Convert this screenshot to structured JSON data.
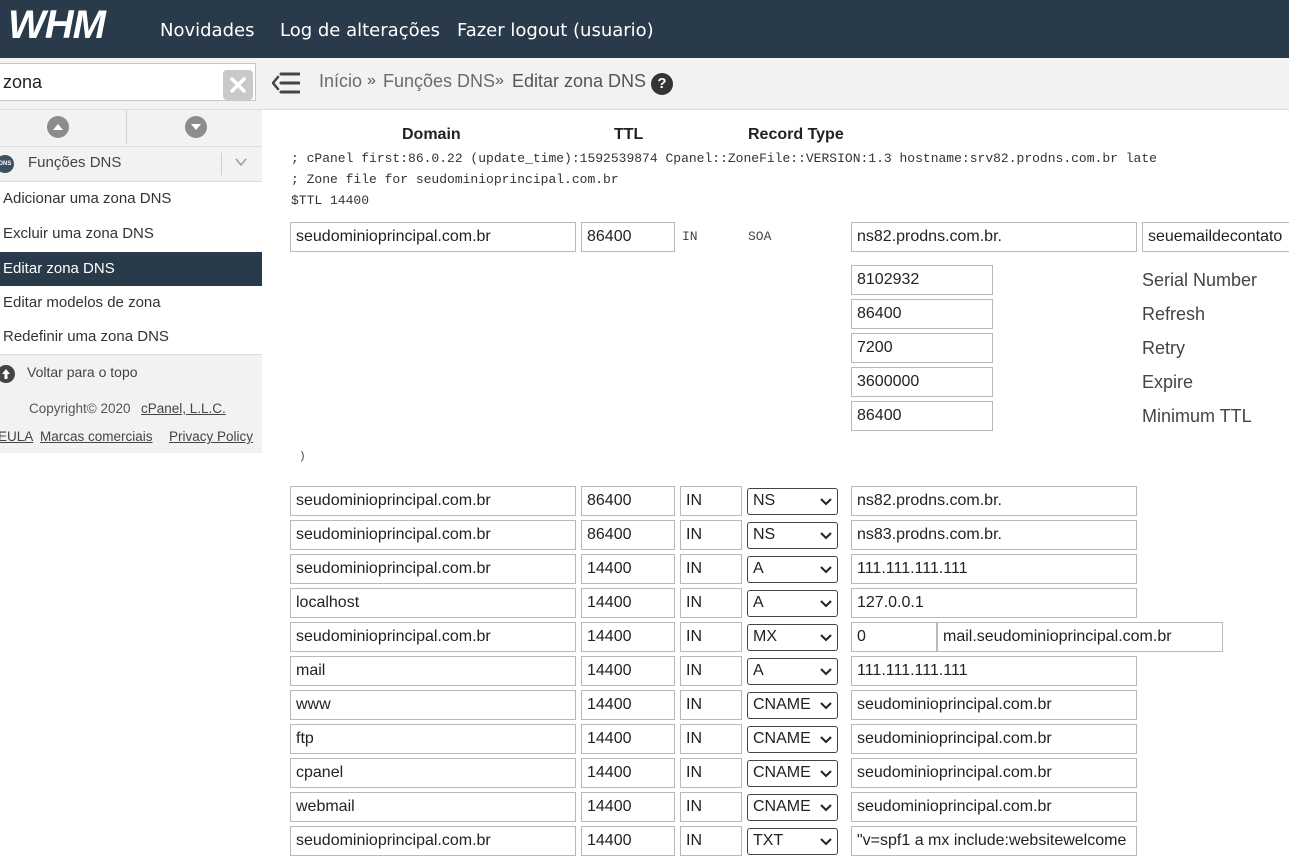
{
  "header": {
    "logo": "WHM",
    "nav": [
      "Novidades",
      "Log de alterações",
      "Fazer logout (usuario)"
    ]
  },
  "sidebar": {
    "search_value": "zona",
    "category_icon": "DNS",
    "category": "Funções DNS",
    "items": [
      {
        "label": "Adicionar uma zona DNS",
        "active": false
      },
      {
        "label": "Excluir uma zona DNS",
        "active": false
      },
      {
        "label": "Editar zona DNS",
        "active": true
      },
      {
        "label": "Editar modelos de zona",
        "active": false
      },
      {
        "label": "Redefinir uma zona DNS",
        "active": false
      }
    ],
    "back_to_top": "Voltar para o topo",
    "footer": {
      "copyright": "Copyright© 2020",
      "company": "cPanel, L.L.C.",
      "links": [
        "EULA",
        "Marcas comerciais",
        "Privacy Policy"
      ]
    }
  },
  "breadcrumb": {
    "items": [
      "Início",
      "Funções DNS",
      "Editar zona DNS"
    ],
    "separator": "»",
    "help": "?"
  },
  "zone": {
    "headers": {
      "domain": "Domain",
      "ttl": "TTL",
      "type": "Record Type"
    },
    "comments": [
      "; cPanel first:86.0.22 (update_time):1592539874 Cpanel::ZoneFile::VERSION:1.3 hostname:srv82.prodns.com.br late",
      "; Zone file for seudominioprincipal.com.br",
      "$TTL 14400"
    ],
    "soa": {
      "domain": "seudominioprincipal.com.br",
      "ttl": "86400",
      "class": "IN",
      "type": "SOA",
      "primary_ns": "ns82.prodns.com.br.",
      "email": "seuemaildecontato",
      "fields": [
        {
          "label": "Serial Number",
          "value": "8102932"
        },
        {
          "label": "Refresh",
          "value": "86400"
        },
        {
          "label": "Retry",
          "value": "7200"
        },
        {
          "label": "Expire",
          "value": "3600000"
        },
        {
          "label": "Minimum TTL",
          "value": "86400"
        }
      ],
      "close": ")"
    },
    "records": [
      {
        "name": "seudominioprincipal.com.br",
        "ttl": "86400",
        "class": "IN",
        "type": "NS",
        "value": "ns82.prodns.com.br."
      },
      {
        "name": "seudominioprincipal.com.br",
        "ttl": "86400",
        "class": "IN",
        "type": "NS",
        "value": "ns83.prodns.com.br."
      },
      {
        "name": "seudominioprincipal.com.br",
        "ttl": "14400",
        "class": "IN",
        "type": "A",
        "value": "111.111.111.111"
      },
      {
        "name": "localhost",
        "ttl": "14400",
        "class": "IN",
        "type": "A",
        "value": "127.0.0.1"
      },
      {
        "name": "seudominioprincipal.com.br",
        "ttl": "14400",
        "class": "IN",
        "type": "MX",
        "priority": "0",
        "value": "mail.seudominioprincipal.com.br"
      },
      {
        "name": "mail",
        "ttl": "14400",
        "class": "IN",
        "type": "A",
        "value": "111.111.111.111"
      },
      {
        "name": "www",
        "ttl": "14400",
        "class": "IN",
        "type": "CNAME",
        "value": "seudominioprincipal.com.br"
      },
      {
        "name": "ftp",
        "ttl": "14400",
        "class": "IN",
        "type": "CNAME",
        "value": "seudominioprincipal.com.br"
      },
      {
        "name": "cpanel",
        "ttl": "14400",
        "class": "IN",
        "type": "CNAME",
        "value": "seudominioprincipal.com.br"
      },
      {
        "name": "webmail",
        "ttl": "14400",
        "class": "IN",
        "type": "CNAME",
        "value": "seudominioprincipal.com.br"
      },
      {
        "name": "seudominioprincipal.com.br",
        "ttl": "14400",
        "class": "IN",
        "type": "TXT",
        "value": "\"v=spf1 a mx include:websitewelcome"
      }
    ]
  }
}
